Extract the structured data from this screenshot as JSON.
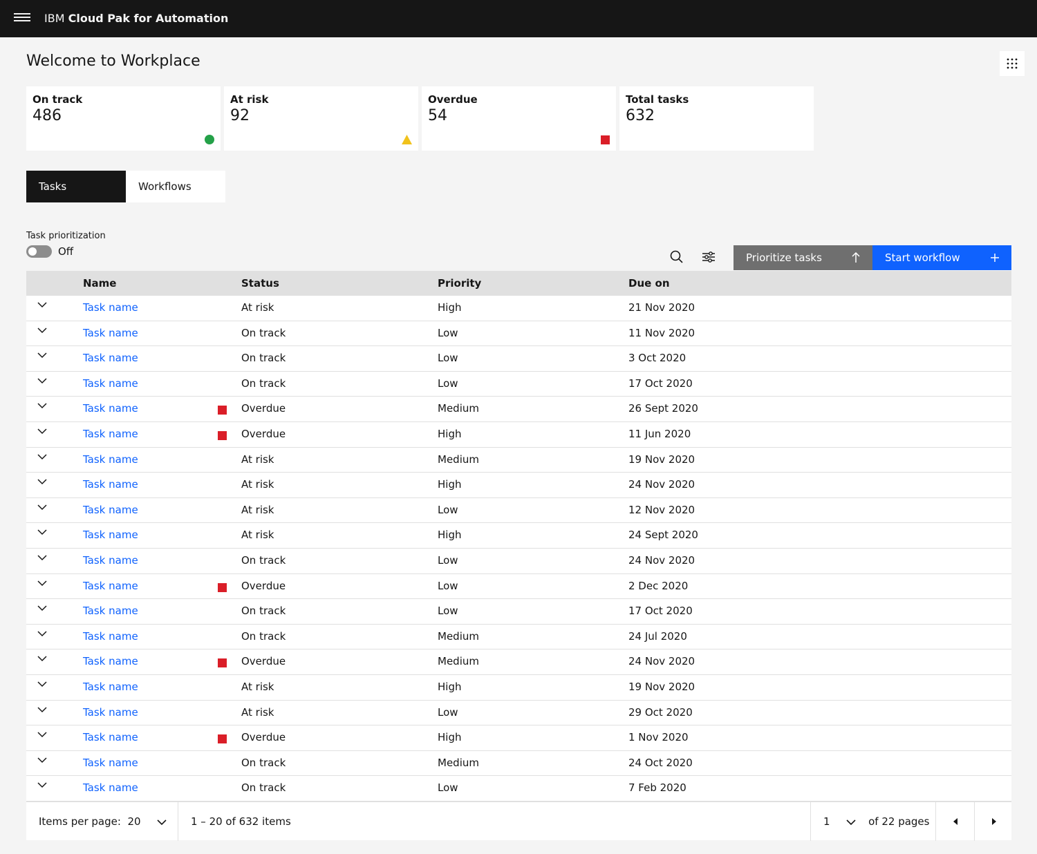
{
  "header": {
    "brand_prefix": "IBM",
    "brand_product": "Cloud Pak for Automation"
  },
  "page": {
    "title": "Welcome to Workplace"
  },
  "tiles": [
    {
      "label": "On track",
      "value": "486",
      "icon": "green-circle-icon",
      "color": "#24a148"
    },
    {
      "label": "At risk",
      "value": "92",
      "icon": "yellow-triangle-icon",
      "color": "#f1c21b"
    },
    {
      "label": "Overdue",
      "value": "54",
      "icon": "red-square-icon",
      "color": "#da1e28"
    },
    {
      "label": "Total tasks",
      "value": "632"
    }
  ],
  "tabs": [
    {
      "label": "Tasks",
      "active": true
    },
    {
      "label": "Workflows",
      "active": false
    }
  ],
  "prioritization": {
    "label": "Task prioritization",
    "state": "Off"
  },
  "toolbar": {
    "prioritize_label": "Prioritize tasks",
    "start_label": "Start workflow"
  },
  "table": {
    "headers": {
      "name": "Name",
      "status": "Status",
      "priority": "Priority",
      "due": "Due on"
    },
    "rows": [
      {
        "name": "Task name",
        "status": "At risk",
        "priority": "High",
        "due": "21 Nov 2020"
      },
      {
        "name": "Task name",
        "status": "On track",
        "priority": "Low",
        "due": "11 Nov 2020"
      },
      {
        "name": "Task name",
        "status": "On track",
        "priority": "Low",
        "due": "3 Oct 2020"
      },
      {
        "name": "Task name",
        "status": "On track",
        "priority": "Low",
        "due": "17 Oct 2020"
      },
      {
        "name": "Task name",
        "status": "Overdue",
        "priority": "Medium",
        "due": "26 Sept 2020"
      },
      {
        "name": "Task name",
        "status": "Overdue",
        "priority": "High",
        "due": "11 Jun 2020"
      },
      {
        "name": "Task name",
        "status": "At risk",
        "priority": "Medium",
        "due": "19 Nov 2020"
      },
      {
        "name": "Task name",
        "status": "At risk",
        "priority": "High",
        "due": "24 Nov 2020"
      },
      {
        "name": "Task name",
        "status": "At risk",
        "priority": "Low",
        "due": "12 Nov 2020"
      },
      {
        "name": "Task name",
        "status": "At risk",
        "priority": "High",
        "due": "24 Sept 2020"
      },
      {
        "name": "Task name",
        "status": "On track",
        "priority": "Low",
        "due": "24 Nov 2020"
      },
      {
        "name": "Task name",
        "status": "Overdue",
        "priority": "Low",
        "due": "2 Dec 2020"
      },
      {
        "name": "Task name",
        "status": "On track",
        "priority": "Low",
        "due": "17 Oct 2020"
      },
      {
        "name": "Task name",
        "status": "On track",
        "priority": "Medium",
        "due": "24 Jul 2020"
      },
      {
        "name": "Task name",
        "status": "Overdue",
        "priority": "Medium",
        "due": "24 Nov 2020"
      },
      {
        "name": "Task name",
        "status": "At risk",
        "priority": "High",
        "due": "19 Nov 2020"
      },
      {
        "name": "Task name",
        "status": "At risk",
        "priority": "Low",
        "due": "29 Oct 2020"
      },
      {
        "name": "Task name",
        "status": "Overdue",
        "priority": "High",
        "due": "1 Nov 2020"
      },
      {
        "name": "Task name",
        "status": "On track",
        "priority": "Medium",
        "due": "24 Oct 2020"
      },
      {
        "name": "Task name",
        "status": "On track",
        "priority": "Low",
        "due": "7 Feb 2020"
      }
    ]
  },
  "pagination": {
    "items_per_page_label": "Items per page:",
    "items_per_page": "20",
    "range": "1 – 20 of 632 items",
    "current_page": "1",
    "total_pages_label": "of 22 pages"
  }
}
